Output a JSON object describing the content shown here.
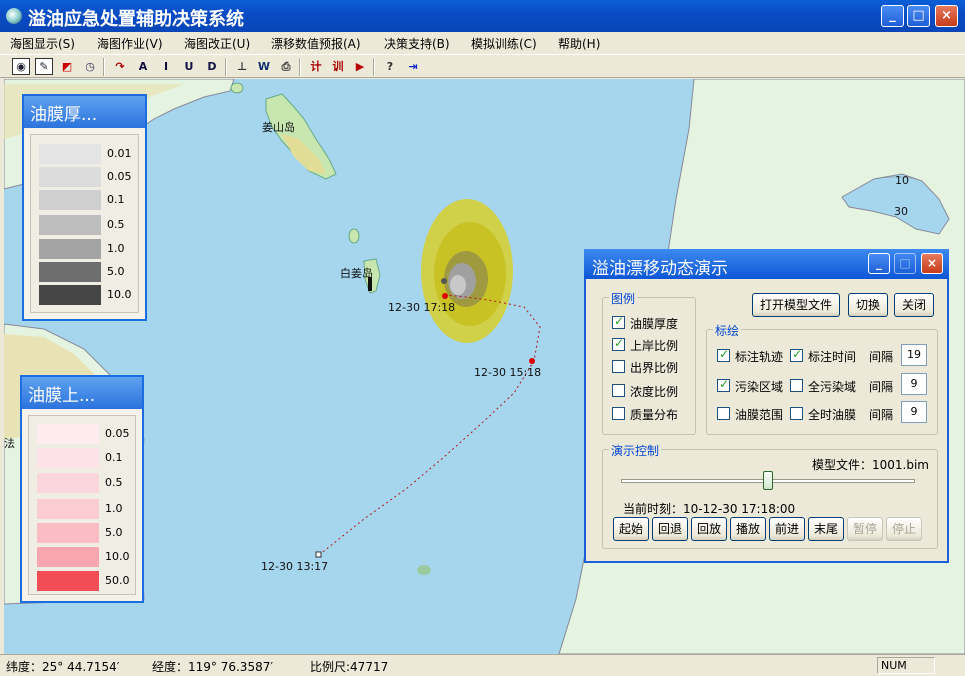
{
  "window": {
    "title": "溢油应急处置辅助决策系统",
    "min": "_",
    "max": "□",
    "close": "×"
  },
  "menu": [
    {
      "label": "海图显示(S)"
    },
    {
      "label": "海图作业(V)"
    },
    {
      "label": "海图改正(U)"
    },
    {
      "label": "漂移数值预报(A)"
    },
    {
      "label": "决策支持(B)"
    },
    {
      "label": "模拟训练(C)"
    },
    {
      "label": "帮助(H)"
    }
  ],
  "toolbar": {
    "btn_w": "W",
    "btn_ji": "计",
    "btn_xun": "训",
    "btn_help": "?"
  },
  "map": {
    "labels": {
      "jiangshan": "姜山岛",
      "baijiang": "白姜岛",
      "depth10": "10",
      "depth30": "30",
      "t1": "12-30 17:18",
      "t2": "12-30 15:18",
      "t3": "12-30 13:17",
      "edge": "法"
    }
  },
  "legend_thickness": {
    "title": "油膜厚...",
    "items": [
      {
        "value": "0.01",
        "color": "#e4e4e4"
      },
      {
        "value": "0.05",
        "color": "#dcdcdc"
      },
      {
        "value": "0.1",
        "color": "#cfcfcf"
      },
      {
        "value": "0.5",
        "color": "#bdbdbd"
      },
      {
        "value": "1.0",
        "color": "#a4a4a4"
      },
      {
        "value": "5.0",
        "color": "#6e6e6e"
      },
      {
        "value": "10.0",
        "color": "#454545"
      }
    ]
  },
  "legend_shore": {
    "title": "油膜上...",
    "items": [
      {
        "value": "0.05",
        "color": "#fdebef"
      },
      {
        "value": "0.1",
        "color": "#fde3e8"
      },
      {
        "value": "0.5",
        "color": "#fcd6dd"
      },
      {
        "value": "1.0",
        "color": "#fcccd3"
      },
      {
        "value": "5.0",
        "color": "#fbbcc4"
      },
      {
        "value": "10.0",
        "color": "#f8a7b1"
      },
      {
        "value": "50.0",
        "color": "#f24c56"
      }
    ]
  },
  "dialog": {
    "title": "溢油漂移动态演示",
    "legend_group": "图例",
    "legend_items": [
      {
        "label": "油膜厚度",
        "checked": true
      },
      {
        "label": "上岸比例",
        "checked": true
      },
      {
        "label": "出界比例",
        "checked": false
      },
      {
        "label": "浓度比例",
        "checked": false
      },
      {
        "label": "质量分布",
        "checked": false
      }
    ],
    "open_button": "打开模型文件",
    "switch_button": "切换",
    "close_button": "关闭",
    "annotate_group": "标绘",
    "annotate": {
      "track": {
        "label": "标注轨迹",
        "checked": true
      },
      "time": {
        "label": "标注时间",
        "checked": true
      },
      "area": {
        "label": "污染区域",
        "checked": true
      },
      "fullarea": {
        "label": "全污染域",
        "checked": false
      },
      "range": {
        "label": "油膜范围",
        "checked": false
      },
      "alltime": {
        "label": "全时油膜",
        "checked": false
      }
    },
    "interval_label": "间隔",
    "intervals": [
      "19",
      "9",
      "9"
    ],
    "control_group": "演示控制",
    "model_file_label": "模型文件：1001.bim",
    "current_time_label": "当前时刻：10-12-30 17:18:00",
    "slider_fraction": 0.5,
    "controls": [
      {
        "label": "起始",
        "enabled": true
      },
      {
        "label": "回退",
        "enabled": true
      },
      {
        "label": "回放",
        "enabled": true
      },
      {
        "label": "播放",
        "enabled": true
      },
      {
        "label": "前进",
        "enabled": true
      },
      {
        "label": "末尾",
        "enabled": true
      },
      {
        "label": "暂停",
        "enabled": false
      },
      {
        "label": "停止",
        "enabled": false
      }
    ]
  },
  "status": {
    "lat": "纬度：25° 44.7154′",
    "lon": "经度：119° 76.3587′",
    "scale": "比例尺:47717",
    "num": "NUM"
  }
}
